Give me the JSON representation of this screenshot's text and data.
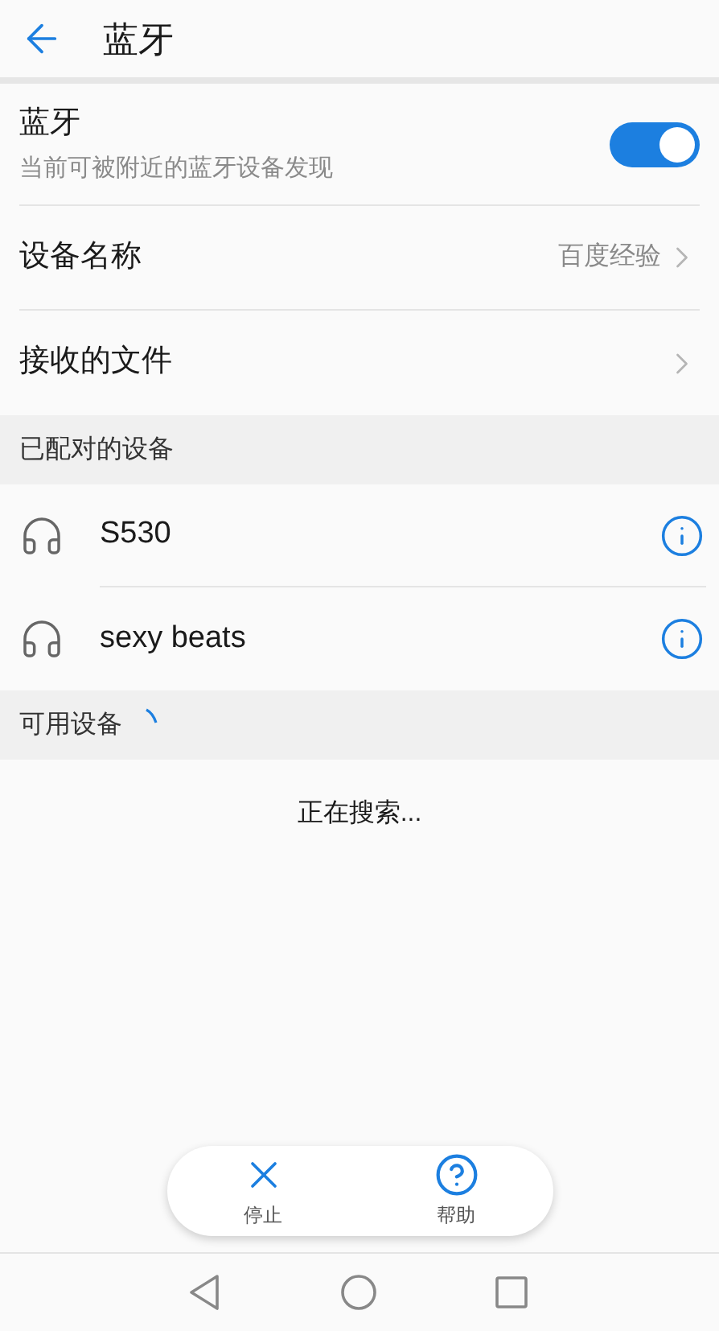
{
  "header": {
    "title": "蓝牙"
  },
  "bluetooth": {
    "label": "蓝牙",
    "subtitle": "当前可被附近的蓝牙设备发现",
    "on": true
  },
  "settings": [
    {
      "label": "设备名称",
      "value": "百度经验"
    },
    {
      "label": "接收的文件"
    }
  ],
  "paired_section": {
    "title": "已配对的设备",
    "devices": [
      {
        "name": "S530"
      },
      {
        "name": "sexy beats"
      }
    ]
  },
  "available_section": {
    "title": "可用设备",
    "searching": true,
    "status": "正在搜索..."
  },
  "actions": [
    {
      "kind": "stop",
      "label": "停止"
    },
    {
      "kind": "help",
      "label": "帮助"
    }
  ]
}
